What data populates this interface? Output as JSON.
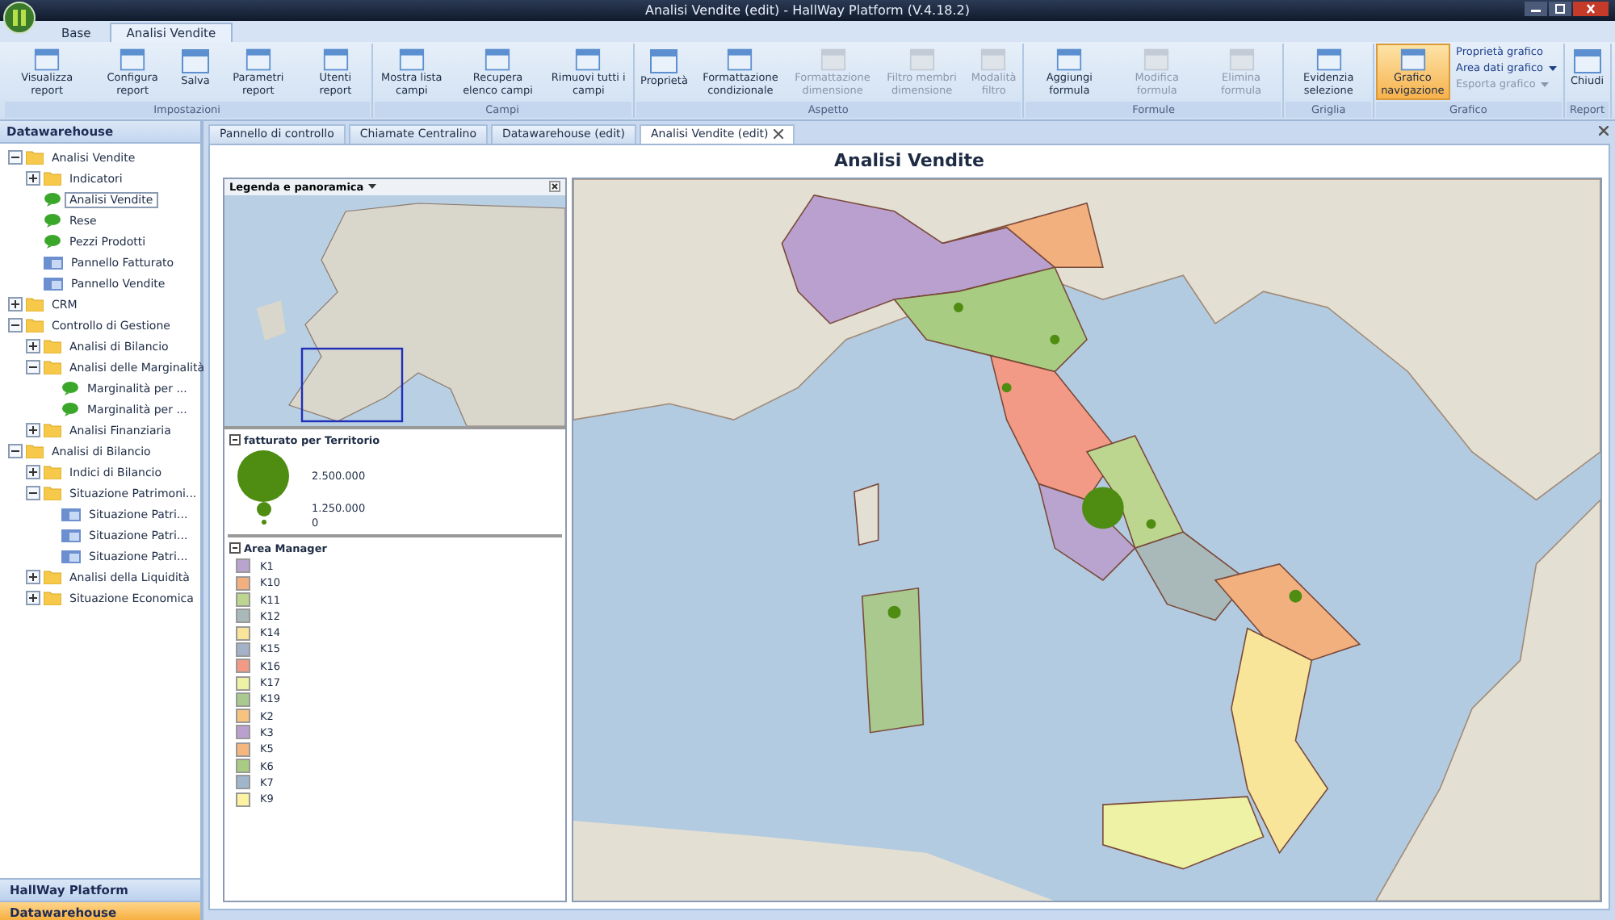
{
  "window": {
    "title": "Analisi Vendite (edit) - HallWay Platform (V.4.18.2)"
  },
  "app_tabs": [
    {
      "label": "Base",
      "selected": false
    },
    {
      "label": "Analisi Vendite",
      "selected": true
    }
  ],
  "ribbon": [
    {
      "label": "Impostazioni",
      "buttons": [
        {
          "label": "Visualizza report",
          "disabled": false,
          "selected": false
        },
        {
          "label": "Configura report",
          "disabled": false,
          "selected": false
        },
        {
          "label": "Salva",
          "disabled": false,
          "selected": false
        },
        {
          "label": "Parametri report",
          "disabled": false,
          "selected": false
        },
        {
          "label": "Utenti report",
          "disabled": false,
          "selected": false
        }
      ]
    },
    {
      "label": "Campi",
      "buttons": [
        {
          "label": "Mostra lista campi",
          "disabled": false,
          "selected": false
        },
        {
          "label": "Recupera elenco campi",
          "disabled": false,
          "selected": false
        },
        {
          "label": "Rimuovi tutti i campi",
          "disabled": false,
          "selected": false
        }
      ]
    },
    {
      "label": "Aspetto",
      "buttons": [
        {
          "label": "Proprietà",
          "disabled": false,
          "selected": false
        },
        {
          "label": "Formattazione condizionale",
          "disabled": false,
          "selected": false
        },
        {
          "label": "Formattazione dimensione",
          "disabled": true,
          "selected": false
        },
        {
          "label": "Filtro membri dimensione",
          "disabled": true,
          "selected": false
        },
        {
          "label": "Modalità filtro",
          "disabled": true,
          "selected": false
        }
      ]
    },
    {
      "label": "Formule",
      "buttons": [
        {
          "label": "Aggiungi formula",
          "disabled": false,
          "selected": false
        },
        {
          "label": "Modifica formula",
          "disabled": true,
          "selected": false
        },
        {
          "label": "Elimina formula",
          "disabled": true,
          "selected": false
        }
      ]
    },
    {
      "label": "Griglia",
      "buttons": [
        {
          "label": "Evidenzia selezione",
          "disabled": false,
          "selected": false
        }
      ]
    },
    {
      "label": "Grafico",
      "buttons": [
        {
          "label": "Grafico navigazione",
          "disabled": false,
          "selected": true
        }
      ],
      "small_buttons": [
        {
          "label": "Proprietà grafico",
          "disabled": false,
          "dropdown": false
        },
        {
          "label": "Area dati grafico",
          "disabled": false,
          "dropdown": true
        },
        {
          "label": "Esporta grafico",
          "disabled": true,
          "dropdown": true
        }
      ]
    },
    {
      "label": "Report",
      "buttons": [
        {
          "label": "Chiudi",
          "disabled": false,
          "selected": false
        }
      ]
    }
  ],
  "sidebar": {
    "title": "Datawarehouse",
    "tree": [
      {
        "label": "Analisi Vendite",
        "kind": "folder",
        "expanded": true,
        "selected": false,
        "children": [
          {
            "label": "Indicatori",
            "kind": "folder",
            "expanded": false,
            "selected": false
          },
          {
            "label": "Analisi Vendite",
            "kind": "report",
            "selected": true
          },
          {
            "label": "Rese",
            "kind": "report",
            "selected": false
          },
          {
            "label": "Pezzi Prodotti",
            "kind": "report",
            "selected": false
          },
          {
            "label": "Pannello Fatturato",
            "kind": "panel",
            "selected": false
          },
          {
            "label": "Pannello Vendite",
            "kind": "panel",
            "selected": false
          }
        ]
      },
      {
        "label": "CRM",
        "kind": "folder",
        "expanded": false,
        "selected": false
      },
      {
        "label": "Controllo di Gestione",
        "kind": "folder",
        "expanded": true,
        "selected": false,
        "children": [
          {
            "label": "Analisi di Bilancio",
            "kind": "folder",
            "expanded": false,
            "selected": false
          },
          {
            "label": "Analisi delle Marginalità",
            "kind": "folder",
            "expanded": true,
            "selected": false,
            "children": [
              {
                "label": "Marginalità per ...",
                "kind": "report",
                "selected": false
              },
              {
                "label": "Marginalità per ...",
                "kind": "report",
                "selected": false
              }
            ]
          },
          {
            "label": "Analisi Finanziaria",
            "kind": "folder",
            "expanded": false,
            "selected": false
          }
        ]
      },
      {
        "label": "Analisi di Bilancio",
        "kind": "folder",
        "expanded": true,
        "selected": false,
        "children": [
          {
            "label": "Indici di Bilancio",
            "kind": "folder",
            "expanded": false,
            "selected": false
          },
          {
            "label": "Situazione Patrimoni...",
            "kind": "folder",
            "expanded": true,
            "selected": false,
            "children": [
              {
                "label": "Situazione Patri...",
                "kind": "panel",
                "selected": false
              },
              {
                "label": "Situazione Patri...",
                "kind": "panel",
                "selected": false
              },
              {
                "label": "Situazione Patri...",
                "kind": "panel",
                "selected": false
              }
            ]
          },
          {
            "label": "Analisi della Liquidità",
            "kind": "folder",
            "expanded": false,
            "selected": false
          },
          {
            "label": "Situazione Economica",
            "kind": "folder",
            "expanded": false,
            "selected": false
          }
        ]
      }
    ],
    "nav": [
      {
        "label": "HallWay Platform",
        "selected": false
      },
      {
        "label": "Datawarehouse",
        "selected": true
      }
    ]
  },
  "doc_tabs": [
    {
      "label": "Pannello di controllo",
      "selected": false
    },
    {
      "label": "Chiamate Centralino",
      "selected": false
    },
    {
      "label": "Datawarehouse (edit)",
      "selected": false
    },
    {
      "label": "Analisi Vendite (edit)",
      "selected": true
    }
  ],
  "report": {
    "title": "Analisi Vendite",
    "legend": {
      "title": "Legenda e panoramica",
      "bubbles": {
        "title": "fatturato per Territorio",
        "items": [
          {
            "label": "2.500.000"
          },
          {
            "label": "1.250.000"
          },
          {
            "label": "0"
          }
        ]
      },
      "areas": {
        "title": "Area Manager",
        "items": [
          {
            "label": "K1",
            "color": "#b9a3cf"
          },
          {
            "label": "K10",
            "color": "#f3b07f"
          },
          {
            "label": "K11",
            "color": "#bcd68f"
          },
          {
            "label": "K12",
            "color": "#a9b9b9"
          },
          {
            "label": "K14",
            "color": "#f8e59a"
          },
          {
            "label": "K15",
            "color": "#a3b1c9"
          },
          {
            "label": "K16",
            "color": "#f29a85"
          },
          {
            "label": "K17",
            "color": "#eef2a5"
          },
          {
            "label": "K19",
            "color": "#a9c98e"
          },
          {
            "label": "K2",
            "color": "#f7c37f"
          },
          {
            "label": "K3",
            "color": "#b9a0cf"
          },
          {
            "label": "K5",
            "color": "#f6b77f"
          },
          {
            "label": "K6",
            "color": "#a8cd82"
          },
          {
            "label": "K7",
            "color": "#9fb6cd"
          },
          {
            "label": "K9",
            "color": "#fbf2a2"
          }
        ]
      }
    }
  }
}
